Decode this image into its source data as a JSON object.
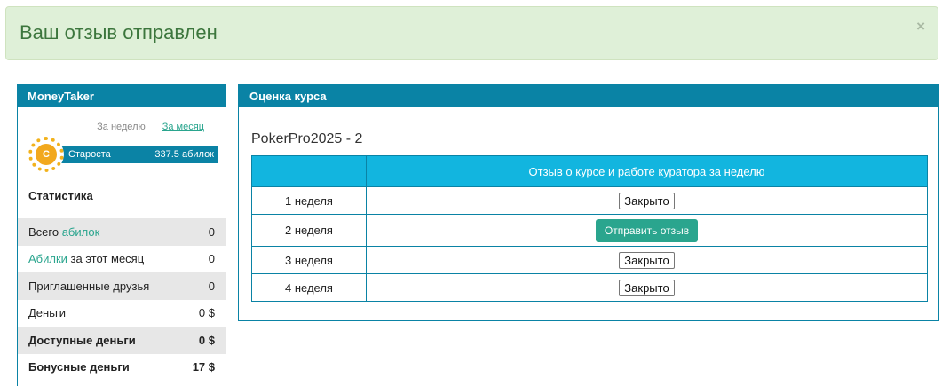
{
  "alert": {
    "message": "Ваш отзыв отправлен",
    "close": "×"
  },
  "left": {
    "title": "MoneyTaker",
    "period": {
      "week": "За неделю",
      "month": "За месяц"
    },
    "rank": {
      "coin": "C",
      "name": "Староста",
      "points": "337.5 абилок"
    },
    "stats_title": "Статистика",
    "stats": [
      {
        "pre": "Всего ",
        "link": "абилок",
        "post": "",
        "value": "0"
      },
      {
        "pre": "",
        "link": "Абилки",
        "post": " за этот месяц",
        "value": "0"
      },
      {
        "pre": "Приглашенные друзья",
        "link": "",
        "post": "",
        "value": "0"
      },
      {
        "pre": "Деньги",
        "link": "",
        "post": "",
        "value": "0 $"
      },
      {
        "pre": "Доступные деньги",
        "link": "",
        "post": "",
        "value": "0 $"
      },
      {
        "pre": "Бонусные деньги",
        "link": "",
        "post": "",
        "value": "17 $"
      }
    ]
  },
  "right": {
    "title": "Оценка курса",
    "course": "PokerPro2025 - 2",
    "table": {
      "header": [
        "",
        "Отзыв о курсе и работе куратора за неделю"
      ],
      "rows": [
        {
          "week": "1 неделя",
          "action": "Закрыто"
        },
        {
          "week": "2 неделя",
          "action": "Отправить отзыв"
        },
        {
          "week": "3 неделя",
          "action": "Закрыто"
        },
        {
          "week": "4 неделя",
          "action": "Закрыто"
        }
      ]
    }
  }
}
